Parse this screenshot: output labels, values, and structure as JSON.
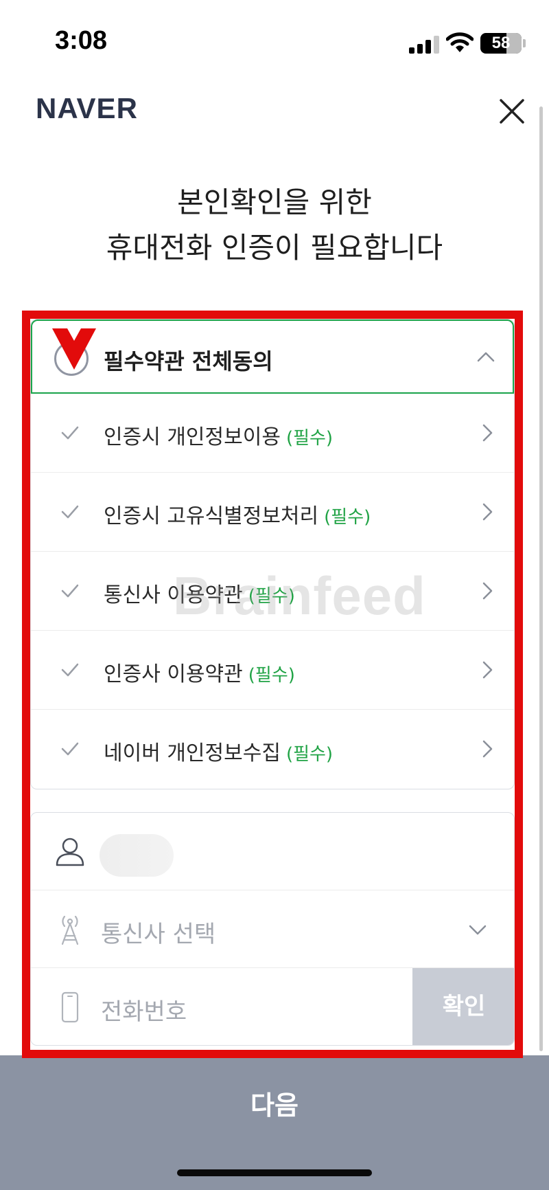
{
  "status_bar": {
    "time": "3:08",
    "battery": "58"
  },
  "header": {
    "logo": "NAVER"
  },
  "headline": {
    "line1": "본인확인을 위한",
    "line2": "휴대전화 인증이 필요합니다"
  },
  "terms": {
    "all_label": "필수약관 전체동의",
    "items": [
      {
        "label": "인증시 개인정보이용",
        "tag": "(필수)"
      },
      {
        "label": "인증시 고유식별정보처리",
        "tag": "(필수)"
      },
      {
        "label": "통신사 이용약관",
        "tag": "(필수)"
      },
      {
        "label": "인증사 이용약관",
        "tag": "(필수)"
      },
      {
        "label": "네이버 개인정보수집",
        "tag": "(필수)"
      }
    ]
  },
  "form": {
    "carrier_placeholder": "통신사 선택",
    "phone_placeholder": "전화번호",
    "confirm_label": "확인"
  },
  "watermark": "Brainfeed",
  "footer": {
    "next_label": "다음"
  },
  "colors": {
    "accent_green": "#20a345",
    "highlight_red": "#e20b0b",
    "next_bar": "#8b93a3",
    "logo": "#2b3349"
  }
}
